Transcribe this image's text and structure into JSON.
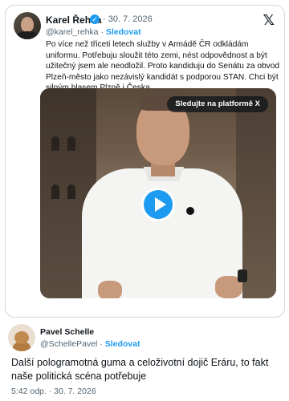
{
  "quoted_post": {
    "author_name": "Karel Řehka",
    "verified_mark": "✓",
    "date": "· 30. 7. 2026",
    "handle": "@karel_rehka",
    "separator": "·",
    "follow_label": "Sledovat",
    "text": "Po více než třiceti letech služby v Armádě ČR odkládám uniformu. Potřebuju sloužit této zemi, nést odpovědnost a být užitečný jsem ale neodložil. Proto kandiduju do Senátu za obvod Plzeň-město jako nezávislý kandidát s podporou STAN. Chci být silným hlasem Plzně i Česka.",
    "video": {
      "watch_label": "Sledujte na platformě X",
      "play_icon": "play-icon"
    }
  },
  "platform_icon": "𝕏",
  "reply": {
    "author_name": "Pavel Schelle",
    "handle": "@SchellePavel",
    "separator": "·",
    "follow_label": "Sledovat",
    "text": "Další pologramotná guma a celoživotní dojič Eráru, to fakt naše politická scéna potřebuje",
    "meta": "5:42 odp. · 30. 7. 2026"
  },
  "colors": {
    "accent": "#1d9bf0",
    "text": "#0f1419",
    "muted": "#536471",
    "border": "#cfd9de"
  }
}
